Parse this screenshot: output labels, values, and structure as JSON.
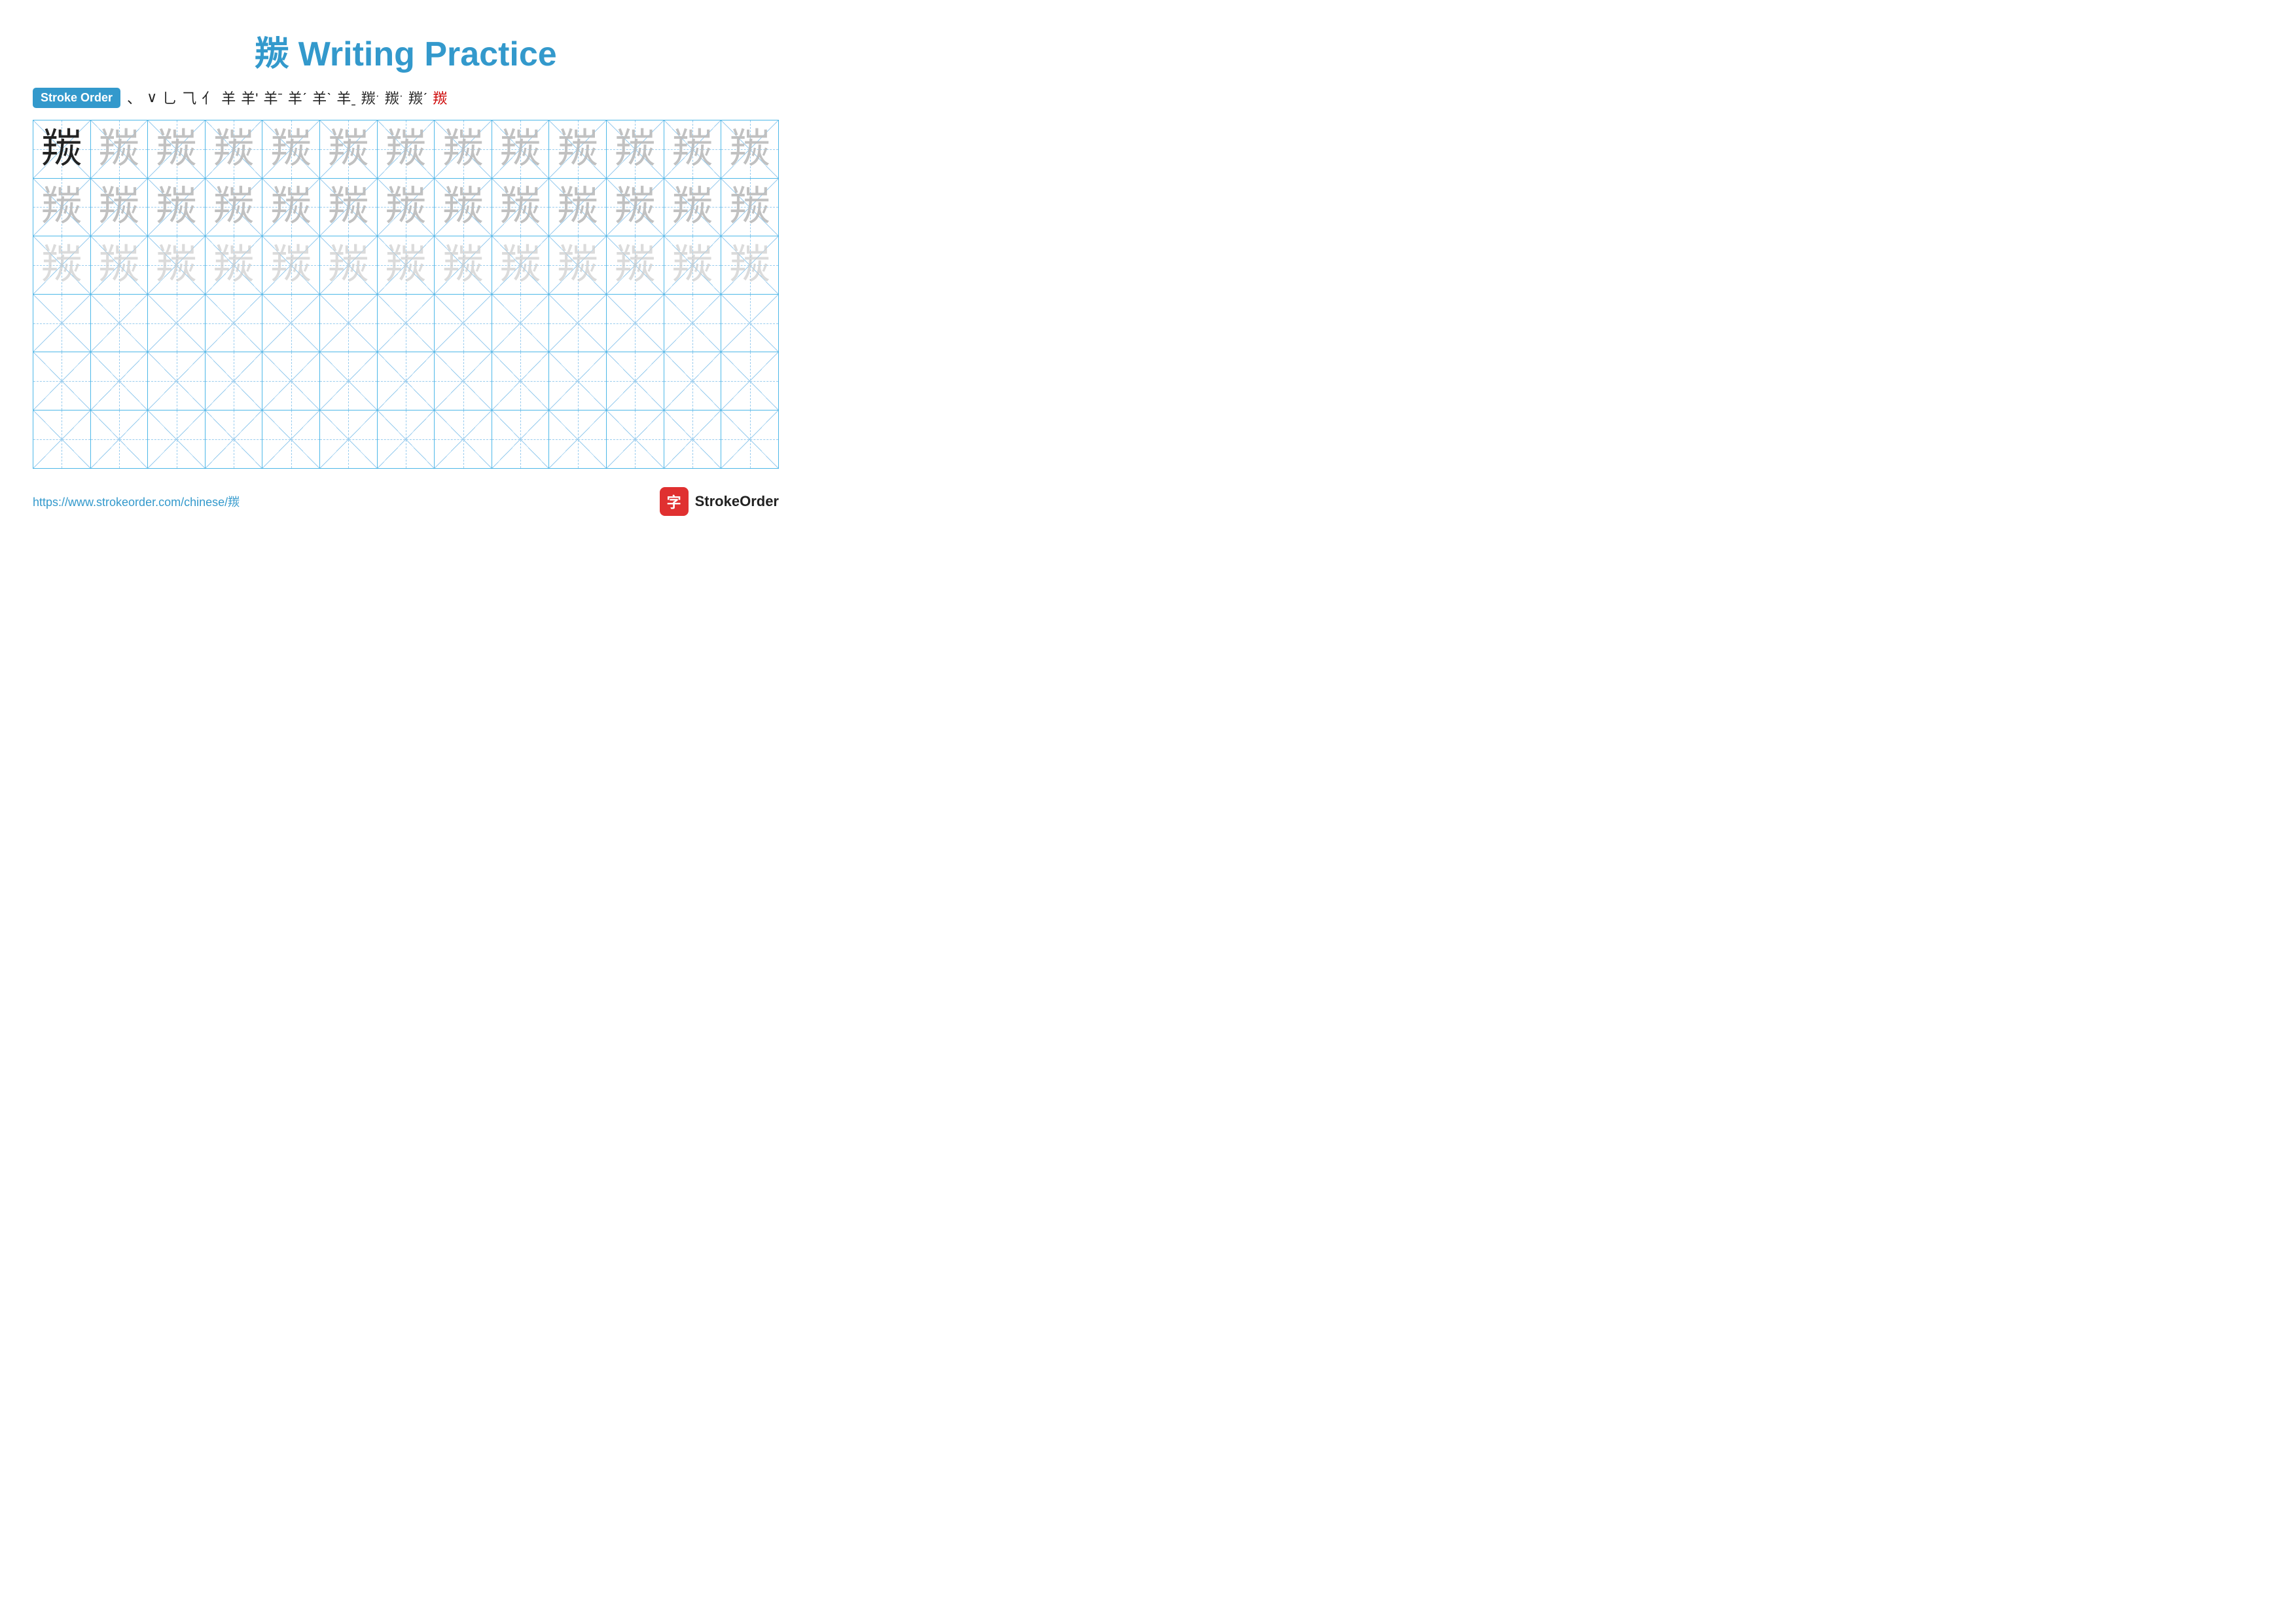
{
  "title": {
    "char": "羰",
    "subtitle": "Writing Practice",
    "full": "羰 Writing Practice"
  },
  "stroke_order": {
    "badge_label": "Stroke Order",
    "strokes": [
      "、",
      "∨",
      "⺃",
      "⺄",
      "⺅",
      "羊",
      "羊'",
      "羊ˉ",
      "羊ˊ",
      "羊ˋ",
      "羊ˍ",
      "羰ˑ",
      "羰ˑ",
      "羰ˊ",
      "羰"
    ]
  },
  "grid": {
    "cols": 13,
    "rows": 6,
    "char": "羰",
    "row_types": [
      "dark_then_light1",
      "light1",
      "light2",
      "empty",
      "empty",
      "empty"
    ]
  },
  "footer": {
    "url": "https://www.strokeorder.com/chinese/羰",
    "logo_text": "StrokeOrder",
    "logo_char": "字"
  }
}
